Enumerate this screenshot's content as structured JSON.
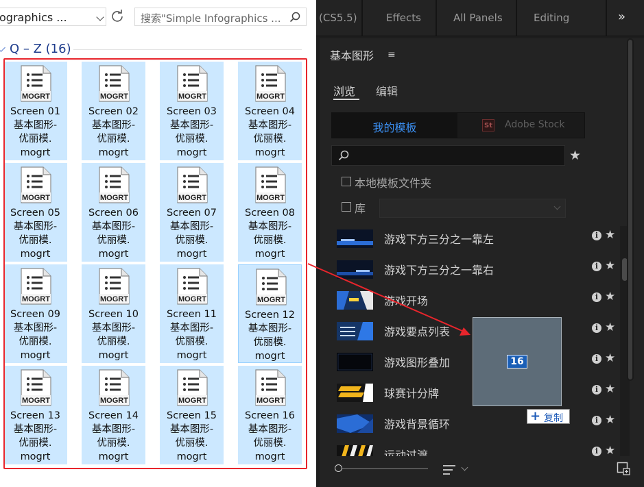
{
  "explorer": {
    "address_text": "ographics ...",
    "search_placeholder": "搜索\"Simple Infographics ...",
    "group_label": "Q – Z (16)",
    "files": [
      {
        "name": "Screen 01",
        "l2": "基本图形-",
        "l3": "优丽模.",
        "ext": "mogrt"
      },
      {
        "name": "Screen 02",
        "l2": "基本图形-",
        "l3": "优丽模.",
        "ext": "mogrt"
      },
      {
        "name": "Screen 03",
        "l2": "基本图形-",
        "l3": "优丽模.",
        "ext": "mogrt"
      },
      {
        "name": "Screen 04",
        "l2": "基本图形-",
        "l3": "优丽模.",
        "ext": "mogrt"
      },
      {
        "name": "Screen 05",
        "l2": "基本图形-",
        "l3": "优丽模.",
        "ext": "mogrt"
      },
      {
        "name": "Screen 06",
        "l2": "基本图形-",
        "l3": "优丽模.",
        "ext": "mogrt"
      },
      {
        "name": "Screen 07",
        "l2": "基本图形-",
        "l3": "优丽模.",
        "ext": "mogrt"
      },
      {
        "name": "Screen 08",
        "l2": "基本图形-",
        "l3": "优丽模.",
        "ext": "mogrt"
      },
      {
        "name": "Screen 09",
        "l2": "基本图形-",
        "l3": "优丽模.",
        "ext": "mogrt"
      },
      {
        "name": "Screen 10",
        "l2": "基本图形-",
        "l3": "优丽模.",
        "ext": "mogrt"
      },
      {
        "name": "Screen 11",
        "l2": "基本图形-",
        "l3": "优丽模.",
        "ext": "mogrt"
      },
      {
        "name": "Screen 12",
        "l2": "基本图形-",
        "l3": "优丽模.",
        "ext": "mogrt"
      },
      {
        "name": "Screen 13",
        "l2": "基本图形-",
        "l3": "优丽模.",
        "ext": "mogrt"
      },
      {
        "name": "Screen 14",
        "l2": "基本图形-",
        "l3": "优丽模.",
        "ext": "mogrt"
      },
      {
        "name": "Screen 15",
        "l2": "基本图形-",
        "l3": "优丽模.",
        "ext": "mogrt"
      },
      {
        "name": "Screen 16",
        "l2": "基本图形-",
        "l3": "优丽模.",
        "ext": "mogrt"
      }
    ],
    "file_icon_label": "MOGRT"
  },
  "premiere": {
    "workspaces": [
      "(CS5.5)",
      "Effects",
      "All Panels",
      "Editing"
    ],
    "more_label": "»",
    "panel_title": "基本图形",
    "panel_menu": "≡",
    "tabs": [
      "浏览",
      "编辑"
    ],
    "seg_my": "我的模板",
    "seg_stock": "Adobe Stock",
    "stock_logo": "St",
    "search_value": "",
    "local_folder": "本地模板文件夹",
    "library": "库",
    "templates": [
      {
        "name": "游戏下方三分之一靠左",
        "theme": "bar-left"
      },
      {
        "name": "游戏下方三分之一靠右",
        "theme": "bar-right"
      },
      {
        "name": "游戏开场",
        "theme": "opening"
      },
      {
        "name": "游戏要点列表",
        "theme": "bullet"
      },
      {
        "name": "游戏图形叠加",
        "theme": "overlay"
      },
      {
        "name": "球赛计分牌",
        "theme": "scoreboard"
      },
      {
        "name": "游戏背景循环",
        "theme": "background"
      },
      {
        "name": "运动过渡",
        "theme": "transition"
      }
    ],
    "info_glyph": "i",
    "star_glyph": "★"
  },
  "drag": {
    "count": "16",
    "action_label": "复制",
    "plus": "+"
  },
  "colors": {
    "selection_outline": "#e8252c",
    "tile_fill": "#cce8ff",
    "accent_blue": "#3b8ff2"
  }
}
